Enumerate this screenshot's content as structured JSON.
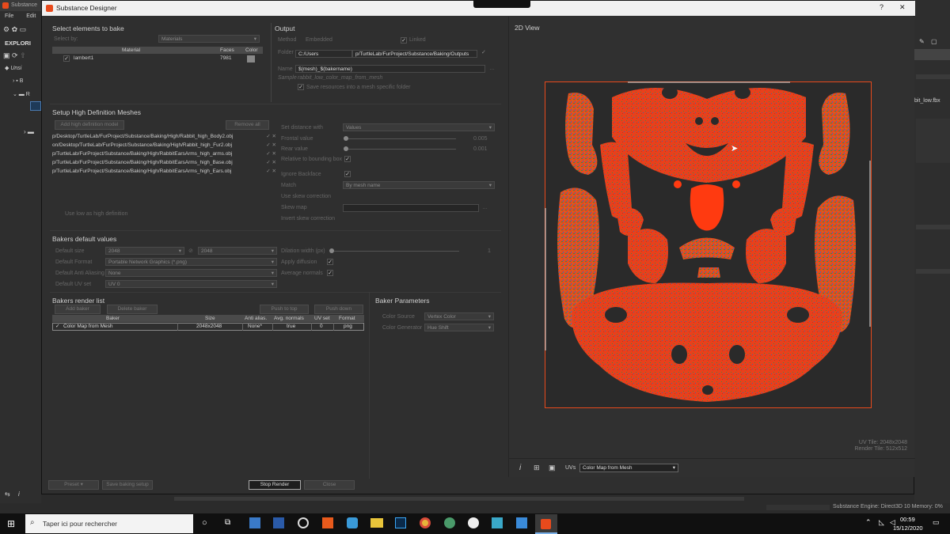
{
  "bg_app": {
    "window_title": "Substance",
    "menu": [
      "File",
      "Edit"
    ],
    "explorer_label": "EXPLORI",
    "tree": [
      "Unsi",
      "B",
      "R"
    ],
    "right_file": "bit_low.fbx"
  },
  "dialog": {
    "title": "Substance Designer",
    "help": "?",
    "close": "✕"
  },
  "select": {
    "title": "Select elements to bake",
    "select_by_label": "Select by:",
    "select_by_value": "Materials",
    "headers": [
      "Material",
      "Faces",
      "Color"
    ],
    "row": {
      "name": "lambert1",
      "faces": "7981"
    }
  },
  "output": {
    "title": "Output",
    "method_label": "Method",
    "method_value": "Embedded",
    "linked_label": "Linked",
    "folder_label": "Folder",
    "folder_value": "C:/Users",
    "folder_rest": "p/TurtleLab/FurProject/Substance/Baking/Outputs",
    "name_label": "Name",
    "name_value": "$(mesh)_$(bakername)",
    "sample_label": "Sample",
    "sample_value": "rabbit_low_color_map_from_mesh",
    "specific_folder": "Save resources into a mesh specific folder"
  },
  "hd": {
    "title": "Setup High Definition Meshes",
    "add_btn": "Add high definition model",
    "remove_btn": "Remove all",
    "meshes": [
      "p/Desktop/TurtleLab/FurProject/Substance/Baking/High/Rabbit_high_Body2.obj",
      "on/Desktop/TurtleLab/FurProject/Substance/Baking/High/Rabbit_high_Fur2.obj",
      "p/TurtleLab/FurProject/Substance/Baking/High/RabbitEarsArms_high_arms.obj",
      "p/TurtleLab/FurProject/Substance/Baking/High/RabbitEarsArms_high_Base.obj",
      "p/TurtleLab/FurProject/Substance/Baking/High/RabbitEarsArms_high_Ears.obj"
    ],
    "use_low": "Use low as high definition",
    "set_distance_label": "Set distance with",
    "set_distance_value": "Values",
    "frontal_label": "Frontal value",
    "frontal_value": "0.005",
    "rear_label": "Rear value",
    "rear_value": "0.001",
    "relative_label": "Relative to bounding box",
    "ignore_label": "Ignore Backface",
    "match_label": "Match",
    "match_value": "By mesh name",
    "skew_corr_label": "Use skew correction",
    "skew_map_label": "Skew map",
    "invert_label": "Invert skew correction"
  },
  "defaults": {
    "title": "Bakers default values",
    "size_label": "Default size",
    "size_w": "2048",
    "size_h": "2048",
    "format_label": "Default Format",
    "format_value": "Portable Network Graphics (*.png)",
    "aa_label": "Default Anti Aliasing",
    "aa_value": "None",
    "uv_label": "Default UV set",
    "uv_value": "UV 0",
    "dilation_label": "Dilation width (px)",
    "dilation_value": "1",
    "apply_diffusion": "Apply diffusion",
    "avg_normals": "Average normals"
  },
  "render_list": {
    "title": "Bakers render list",
    "add_btn": "Add baker",
    "delete_btn": "Delete baker",
    "push_top": "Push to top",
    "push_down": "Push down",
    "headers": [
      "Baker",
      "Size",
      "Anti alias.",
      "Avg. normals",
      "UV set",
      "Format"
    ],
    "row": {
      "name": "Color Map from Mesh",
      "size": "2048x2048",
      "aa": "None*",
      "avg": "true",
      "uv": "0",
      "format": "png"
    }
  },
  "params": {
    "title": "Baker Parameters",
    "source_label": "Color Source",
    "source_value": "Vertex Color",
    "gen_label": "Color Generator",
    "gen_value": "Hue Shift"
  },
  "bottom": {
    "preset": "Preset",
    "save_setup": "Save baking setup",
    "stop_render": "Stop Render",
    "close": "Close"
  },
  "view2d": {
    "title": "2D View",
    "uv_tile": "UV Tile: 2048x2048",
    "render_tile": "Render Tile: 512x512",
    "info": "i",
    "uvs_label": "UVs",
    "map_select": "Color Map from Mesh"
  },
  "status": {
    "engine": "Substance Engine: Direct3D 10  Memory: 0%"
  },
  "taskbar": {
    "search": "Taper ici pour rechercher",
    "time": "00:59",
    "date": "15/12/2020"
  },
  "colors": {
    "accent": "#e84a1c",
    "uv_red": "#e8401c",
    "bg": "#2b2b2b"
  }
}
